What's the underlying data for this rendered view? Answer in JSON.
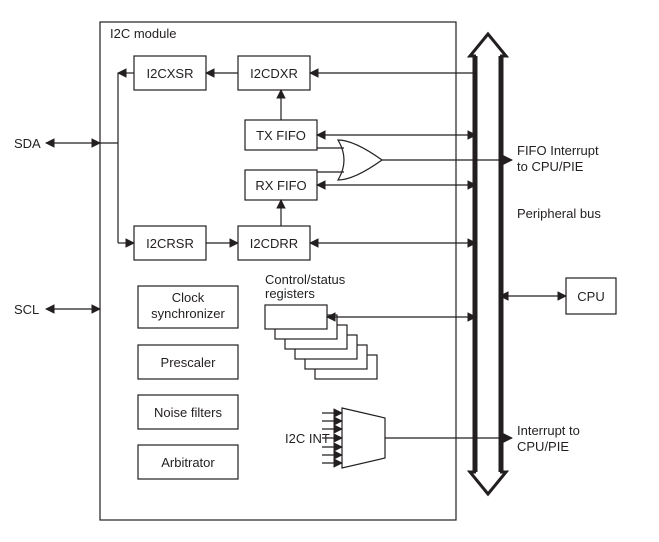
{
  "module": {
    "title": "I2C module"
  },
  "signals": {
    "sda": "SDA",
    "scl": "SCL"
  },
  "blocks": {
    "i2cxsr": "I2CXSR",
    "i2cdxr": "I2CDXR",
    "txfifo": "TX FIFO",
    "rxfifo": "RX FIFO",
    "i2crsr": "I2CRSR",
    "i2cdrr": "I2CDRR",
    "clk_sync_l1": "Clock",
    "clk_sync_l2": "synchronizer",
    "prescaler": "Prescaler",
    "noise_filters": "Noise filters",
    "arbitrator": "Arbitrator",
    "ctrl_status_l1": "Control/status",
    "ctrl_status_l2": "registers",
    "i2c_int": "I2C INT",
    "cpu": "CPU"
  },
  "labels": {
    "fifo_int_l1": "FIFO Interrupt",
    "fifo_int_l2": "to CPU/PIE",
    "periph_bus": "Peripheral bus",
    "int_l1": "Interrupt to",
    "int_l2": "CPU/PIE"
  },
  "chart_data": {
    "type": "block-diagram",
    "module": "I2C module",
    "external_pins": [
      {
        "name": "SDA",
        "dir": "bidirectional"
      },
      {
        "name": "SCL",
        "dir": "bidirectional"
      }
    ],
    "blocks": [
      "I2CXSR",
      "I2CDXR",
      "TX FIFO",
      "RX FIFO",
      "I2CRSR",
      "I2CDRR",
      "Clock synchronizer",
      "Prescaler",
      "Noise filters",
      "Arbitrator",
      "Control/status registers",
      "I2C INT (interrupt mux)",
      "CPU"
    ],
    "buses": [
      {
        "name": "Peripheral bus",
        "direction": "bidirectional",
        "connects": [
          "I2CDXR",
          "TX FIFO",
          "RX FIFO",
          "I2CDRR",
          "Control/status registers",
          "CPU",
          "I2C INT"
        ]
      }
    ],
    "outputs_to_cpu": [
      {
        "signal": "FIFO Interrupt to CPU/PIE",
        "sources_or": [
          "TX FIFO",
          "RX FIFO"
        ]
      },
      {
        "signal": "Interrupt to CPU/PIE",
        "source": "I2C INT mux (multiple internal sources)"
      }
    ],
    "dataflow": [
      {
        "from": "Peripheral bus",
        "to": "I2CDXR"
      },
      {
        "from": "I2CDXR",
        "to": "I2CXSR"
      },
      {
        "from": "I2CXSR",
        "to": "SDA"
      },
      {
        "from": "SDA",
        "to": "I2CRSR"
      },
      {
        "from": "I2CRSR",
        "to": "I2CDRR"
      },
      {
        "from": "I2CDRR",
        "to": "Peripheral bus"
      },
      {
        "from": "TX FIFO",
        "to": "I2CDXR"
      },
      {
        "from": "I2CDRR",
        "via": "RX FIFO",
        "to": "Peripheral bus"
      }
    ]
  }
}
